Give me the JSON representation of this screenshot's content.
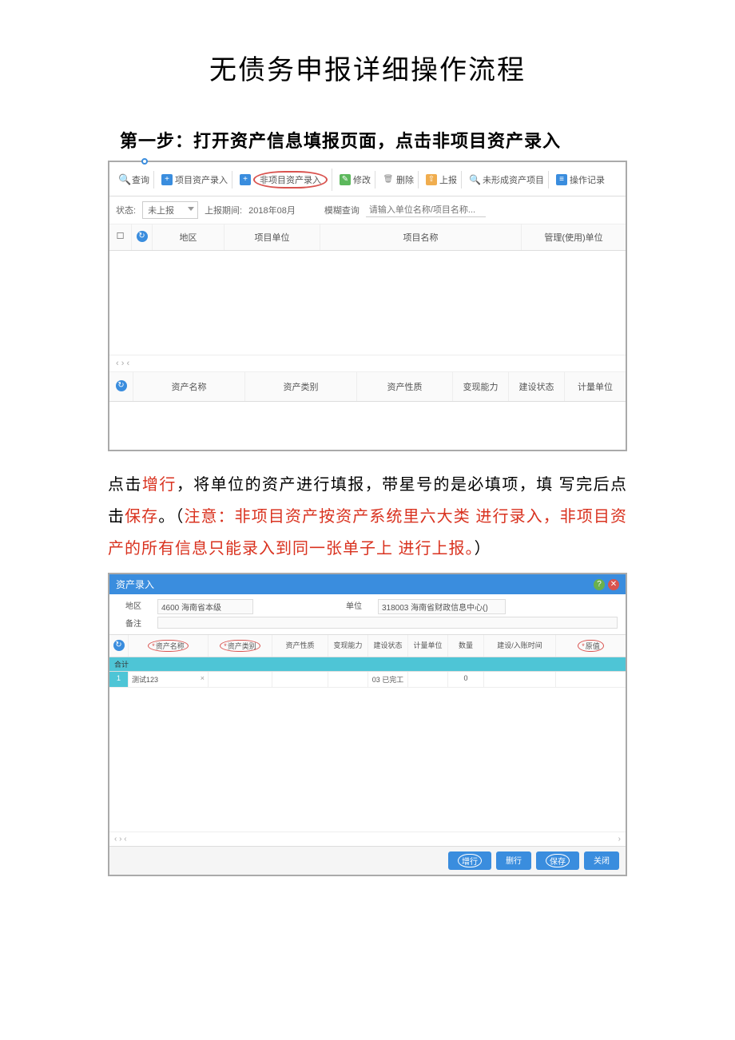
{
  "title": "无债务申报详细操作流程",
  "step1": "第一步：打开资产信息填报页面，点击非项目资产录入",
  "s1": {
    "toolbar": {
      "query": "查询",
      "proj_entry": "项目资产录入",
      "nonproj_entry": "非项目资产录入",
      "modify": "修改",
      "delete": "删除",
      "report": "上报",
      "unformed": "未形成资产项目",
      "oplog": "操作记录"
    },
    "filters": {
      "status_label": "状态:",
      "status_value": "未上报",
      "period_label": "上报期间:",
      "period_value": "2018年08月",
      "fuzzy_label": "模糊查询",
      "fuzzy_placeholder": "请输入单位名称/项目名称..."
    },
    "cols": {
      "region": "地区",
      "proj_unit": "项目单位",
      "proj_name": "项目名称",
      "mgr_unit": "管理(使用)单位"
    },
    "pager": "‹    ›  ‹",
    "sub": {
      "asset_name": "资产名称",
      "asset_cat": "资产类别",
      "asset_nature": "资产性质",
      "liquidity": "变现能力",
      "build_status": "建设状态",
      "unit": "计量单位"
    }
  },
  "para2_pre": "点击",
  "para2_a": "增行",
  "para2_mid1": "，将单位的资产进行填报，带星号的是必填项，填 写完后点击",
  "para2_b": "保存",
  "para2_mid2": "。（",
  "para2_red": "注意：非项目资产按资产系统里六大类 进行录入，非项目资产的所有信息只能录入到同一张单子上 进行上报。",
  "para2_end": "）",
  "s2": {
    "header": "资产录入",
    "form": {
      "region_label": "地区",
      "region_value": "4600 海南省本级",
      "unit_label": "单位",
      "unit_value": "318003 海南省财政信息中心()",
      "remark_label": "备注"
    },
    "cols": {
      "asset_name": "资产名称",
      "asset_cat": "资产类别",
      "asset_nature": "资产性质",
      "liquidity": "变现能力",
      "build_status": "建设状态",
      "unit": "计量单位",
      "qty": "数量",
      "time": "建设/入账时间",
      "orig": "原值"
    },
    "total_label": "合计",
    "row": {
      "idx": "1",
      "name": "测试123",
      "status": "03 已完工",
      "qty": "0"
    },
    "pager": "‹  ›  ‹",
    "pager_right": "›",
    "footer": {
      "add": "增行",
      "del": "删行",
      "save": "保存",
      "close": "关闭"
    }
  }
}
